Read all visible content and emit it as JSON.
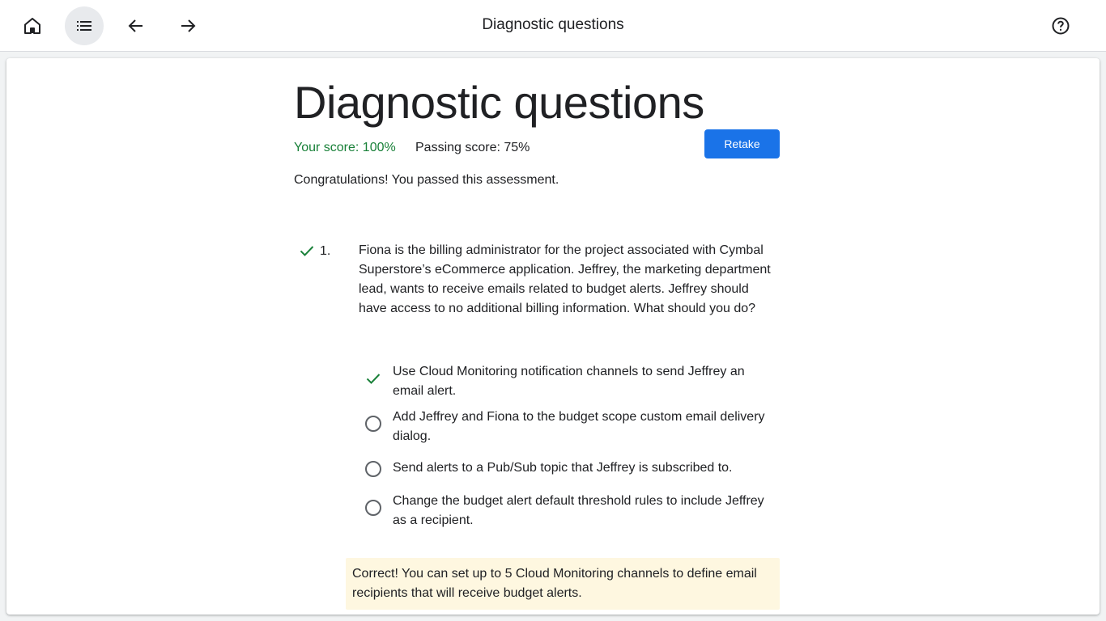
{
  "topbar": {
    "title": "Diagnostic questions",
    "icons": {
      "home": "home-icon",
      "list": "list-icon",
      "back": "arrow-back-icon",
      "forward": "arrow-forward-icon",
      "help": "help-icon"
    }
  },
  "assessment": {
    "title": "Diagnostic questions",
    "your_score": "Your score: 100%",
    "passing_score": "Passing score: 75%",
    "retake_label": "Retake",
    "result_message": "Congratulations! You passed this assessment."
  },
  "question": {
    "number": "1.",
    "status": "correct",
    "text": "Fiona is the billing administrator for the project associated with Cymbal Superstore’s eCommerce application. Jeffrey, the marketing department lead, wants to receive emails related to budget alerts. Jeffrey should have access to no additional billing information. What should you do?",
    "options": [
      {
        "text": "Use Cloud Monitoring notification channels to send Jeffrey an email alert.",
        "selected": true
      },
      {
        "text": "Add Jeffrey and Fiona to the budget scope custom email delivery dialog.",
        "selected": false
      },
      {
        "text": "Send alerts to a Pub/Sub topic that Jeffrey is subscribed to.",
        "selected": false
      },
      {
        "text": "Change the budget alert default threshold rules to include Jeffrey as a recipient.",
        "selected": false
      }
    ],
    "feedback": "Correct! You can set up to 5 Cloud Monitoring channels to define email recipients that will receive budget alerts."
  },
  "colors": {
    "accent": "#1a73e8",
    "correct": "#188038",
    "feedback_bg": "#fef7e0"
  }
}
